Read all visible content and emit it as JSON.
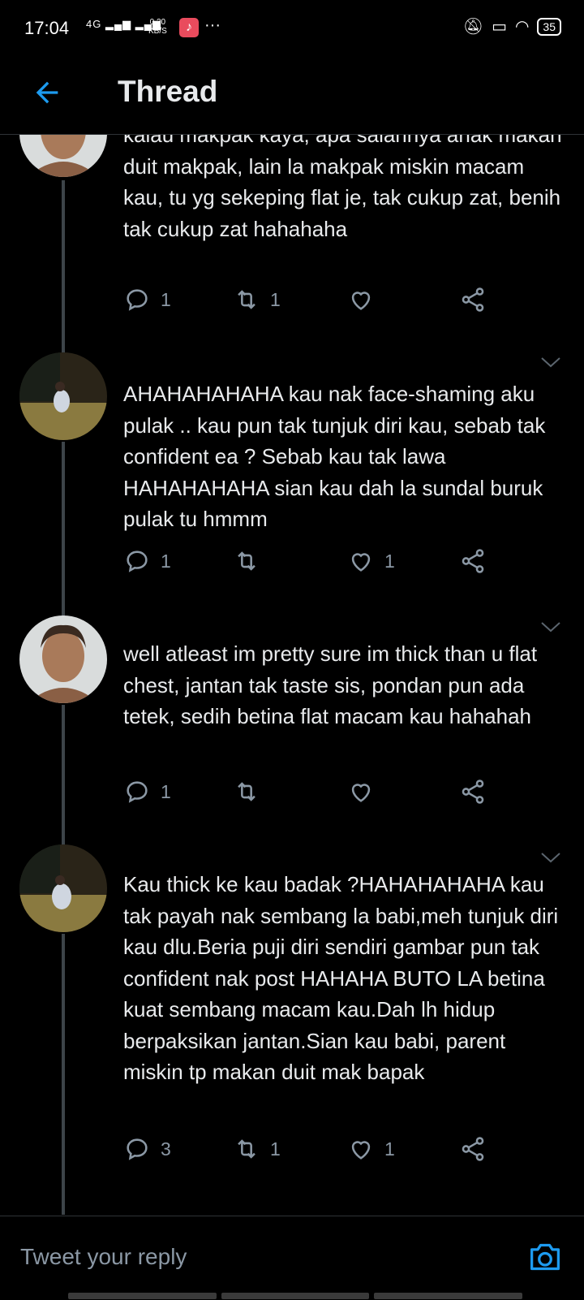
{
  "status_bar": {
    "time": "17:04",
    "network": "4G",
    "speed_value": "0.20",
    "speed_unit": "KB/S",
    "battery": "35"
  },
  "header": {
    "title": "Thread"
  },
  "tweets": [
    {
      "text": "kalau makpak kaya, apa salahnya anak makan duit makpak, lain la makpak miskin macam kau, tu yg sekeping flat je, tak cukup zat, benih tak cukup zat hahahaha",
      "replies": "1",
      "retweets": "1",
      "likes": ""
    },
    {
      "text": "AHAHAHAHAHA kau nak face-shaming aku pulak .. kau pun tak tunjuk diri kau, sebab tak confident ea ? Sebab kau tak lawa HAHAHAHAHA sian kau dah la sundal buruk pulak tu hmmm",
      "replies": "1",
      "retweets": "",
      "likes": "1"
    },
    {
      "text": "well atleast im pretty sure im thick than u flat chest, jantan tak taste sis, pondan pun ada tetek, sedih betina flat macam kau hahahah",
      "replies": "1",
      "retweets": "",
      "likes": ""
    },
    {
      "text": "Kau thick ke kau badak ?HAHAHAHAHA kau tak payah nak sembang la babi,meh tunjuk diri kau dlu.Beria puji diri sendiri gambar pun tak confident nak post HAHAHA BUTO LA betina kuat sembang macam kau.Dah lh hidup berpaksikan jantan.Sian kau babi, parent miskin tp makan duit mak bapak",
      "replies": "3",
      "retweets": "1",
      "likes": "1"
    }
  ],
  "reply_box": {
    "placeholder": "Tweet your reply"
  },
  "colors": {
    "accent": "#1d9bf0",
    "muted": "#8b98a5",
    "divider": "#2f3336"
  }
}
